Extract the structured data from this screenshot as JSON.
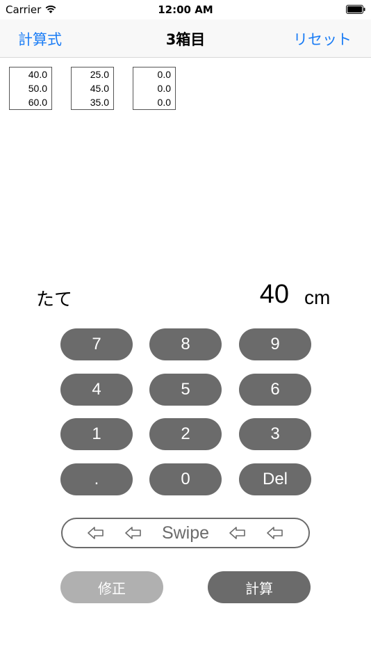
{
  "status_bar": {
    "carrier": "Carrier",
    "time": "12:00 AM"
  },
  "nav": {
    "left_label": "計算式",
    "title": "3箱目",
    "right_label": "リセット",
    "accent_color": "#1a7cf5"
  },
  "boxes": [
    {
      "values": [
        "40.0",
        "50.0",
        "60.0"
      ]
    },
    {
      "values": [
        "25.0",
        "45.0",
        "35.0"
      ]
    },
    {
      "values": [
        "0.0",
        "0.0",
        "0.0"
      ]
    }
  ],
  "input": {
    "label": "たて",
    "value": "40",
    "unit": "cm"
  },
  "keypad": {
    "keys": [
      "7",
      "8",
      "9",
      "4",
      "5",
      "6",
      "1",
      "2",
      "3",
      ".",
      "0",
      "Del"
    ],
    "key_color": "#6b6b6b"
  },
  "swipe": {
    "label": "Swipe",
    "arrow_icon": "hollow-left-arrow-icon"
  },
  "buttons": {
    "fix_label": "修正",
    "calc_label": "計算",
    "fix_color": "#b0b0b0",
    "calc_color": "#6b6b6b"
  }
}
